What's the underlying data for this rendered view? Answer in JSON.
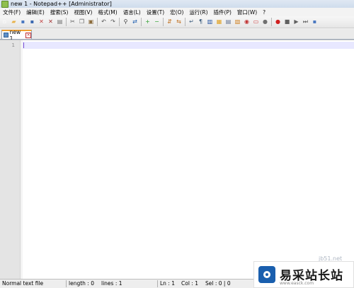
{
  "window": {
    "title": "new 1 - Notepad++ [Administrator]"
  },
  "menu": [
    "文件(F)",
    "编辑(E)",
    "搜索(S)",
    "视图(V)",
    "格式(M)",
    "语言(L)",
    "设置(T)",
    "宏(O)",
    "运行(R)",
    "插件(P)",
    "窗口(W)",
    "?"
  ],
  "toolbar": {
    "buttons": [
      {
        "name": "new-file-icon",
        "glyph": "▫",
        "color": "#ffffff"
      },
      {
        "name": "open-file-icon",
        "glyph": "▰",
        "color": "#e8b24a"
      },
      {
        "name": "save-icon",
        "glyph": "▪",
        "color": "#4a78c0"
      },
      {
        "name": "save-all-icon",
        "glyph": "▪",
        "color": "#3a68b0"
      },
      {
        "name": "close-icon",
        "glyph": "✕",
        "color": "#c04040"
      },
      {
        "name": "close-all-icon",
        "glyph": "✕",
        "color": "#a03030"
      },
      {
        "name": "print-icon",
        "glyph": "▤",
        "color": "#707070"
      },
      {
        "sep": true
      },
      {
        "name": "cut-icon",
        "glyph": "✂",
        "color": "#606060"
      },
      {
        "name": "copy-icon",
        "glyph": "❐",
        "color": "#606060"
      },
      {
        "name": "paste-icon",
        "glyph": "▣",
        "color": "#8a6a3a"
      },
      {
        "sep": true
      },
      {
        "name": "undo-icon",
        "glyph": "↶",
        "color": "#505050"
      },
      {
        "name": "redo-icon",
        "glyph": "↷",
        "color": "#505050"
      },
      {
        "sep": true
      },
      {
        "name": "find-icon",
        "glyph": "⚲",
        "color": "#404040"
      },
      {
        "name": "replace-icon",
        "glyph": "⇄",
        "color": "#2060b0"
      },
      {
        "sep": true
      },
      {
        "name": "zoom-in-icon",
        "glyph": "+",
        "color": "#30a030"
      },
      {
        "name": "zoom-out-icon",
        "glyph": "−",
        "color": "#30a030"
      },
      {
        "sep": true
      },
      {
        "name": "sync-vertical-icon",
        "glyph": "⇵",
        "color": "#c07020"
      },
      {
        "name": "sync-horizontal-icon",
        "glyph": "⇆",
        "color": "#c07020"
      },
      {
        "sep": true
      },
      {
        "name": "word-wrap-icon",
        "glyph": "↵",
        "color": "#406080"
      },
      {
        "name": "show-all-characters-icon",
        "glyph": "¶",
        "color": "#406080"
      },
      {
        "name": "indent-guide-icon",
        "glyph": "▥",
        "color": "#2050a0"
      },
      {
        "name": "document-map-icon",
        "glyph": "▦",
        "color": "#e0a020"
      },
      {
        "name": "function-list-icon",
        "glyph": "▤",
        "color": "#607090"
      },
      {
        "name": "folder-as-workspace-icon",
        "glyph": "▧",
        "color": "#d08020"
      },
      {
        "name": "monitoring-icon",
        "glyph": "◉",
        "color": "#c03030"
      },
      {
        "name": "highlight-icon",
        "glyph": "▭",
        "color": "#d04040"
      },
      {
        "name": "misc-icon",
        "glyph": "●",
        "color": "#707070"
      },
      {
        "sep": true
      },
      {
        "name": "record-macro-icon",
        "glyph": "●",
        "color": "#d02020"
      },
      {
        "name": "stop-record-icon",
        "glyph": "■",
        "color": "#606060"
      },
      {
        "name": "playback-macro-icon",
        "glyph": "▶",
        "color": "#606060"
      },
      {
        "name": "run-macro-multiple-icon",
        "glyph": "⏭",
        "color": "#606060"
      },
      {
        "name": "save-macro-icon",
        "glyph": "▪",
        "color": "#4a78c0"
      }
    ]
  },
  "tab": {
    "label": "new 1"
  },
  "editor": {
    "line_number": "1"
  },
  "statusbar": {
    "file_type": "Normal text file",
    "length": "length : 0",
    "lines": "lines : 1",
    "ln": "Ln : 1",
    "col": "Col : 1",
    "sel": "Sel : 0 | 0"
  },
  "watermark": {
    "brand": "易采站长站",
    "url": "www.easck.com",
    "domain": "jb51.net"
  }
}
